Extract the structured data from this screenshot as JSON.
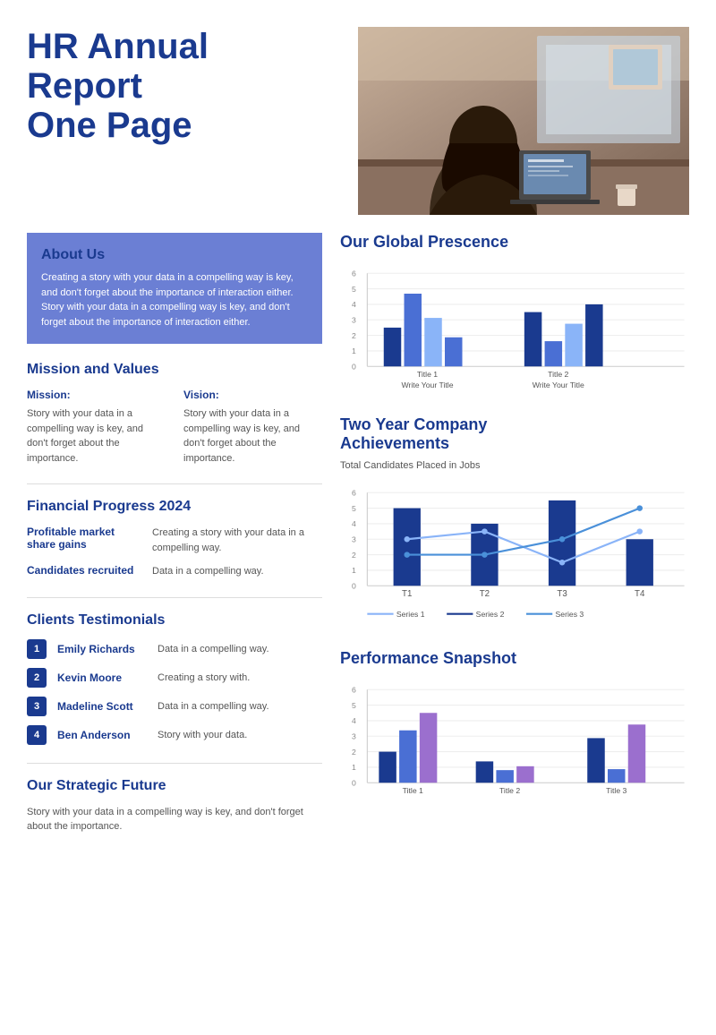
{
  "header": {
    "title_line1": "HR Annual",
    "title_line2": "Report",
    "title_line3": "One Page"
  },
  "about_us": {
    "title": "About Us",
    "text": "Creating a story with your data in a compelling way is key, and don't forget about the importance of interaction either. Story with your data in a compelling way is key, and don't forget about the importance of interaction either."
  },
  "mission_values": {
    "section_title": "Mission and Values",
    "mission_label": "Mission:",
    "mission_text": "Story with your data in a compelling way is key, and don't forget about the importance.",
    "vision_label": "Vision:",
    "vision_text": "Story with your data in a compelling way is key, and don't forget about the importance."
  },
  "financial": {
    "section_title": "Financial Progress 2024",
    "rows": [
      {
        "label": "Profitable market share gains",
        "value": "Creating a story with your data in a compelling way."
      },
      {
        "label": "Candidates recruited",
        "value": "Data in a compelling way."
      }
    ]
  },
  "testimonials": {
    "section_title": "Clients Testimonials",
    "items": [
      {
        "num": "1",
        "name": "Emily Richards",
        "text": "Data in a compelling way."
      },
      {
        "num": "2",
        "name": "Kevin Moore",
        "text": "Creating a story with."
      },
      {
        "num": "3",
        "name": "Madeline Scott",
        "text": "Data in a compelling way."
      },
      {
        "num": "4",
        "name": "Ben Anderson",
        "text": "Story with your data."
      }
    ]
  },
  "strategic_future": {
    "section_title": "Our Strategic Future",
    "text": "Story with your data in a compelling way is key, and don't forget about the importance."
  },
  "global_presence": {
    "section_title": "Our Global Prescence",
    "chart": {
      "y_labels": [
        "6",
        "5",
        "4",
        "3",
        "2",
        "1",
        "0"
      ],
      "groups": [
        {
          "label": "Title 1",
          "subtitle": "Write Your Title",
          "bars": [
            {
              "color": "dark-blue",
              "height": 45
            },
            {
              "color": "medium-blue",
              "height": 80
            },
            {
              "color": "light-blue",
              "height": 55
            },
            {
              "color": "medium-blue",
              "height": 35
            }
          ]
        },
        {
          "label": "Title 2",
          "subtitle": "Write Your Title",
          "bars": [
            {
              "color": "dark-blue",
              "height": 65
            },
            {
              "color": "medium-blue",
              "height": 30
            },
            {
              "color": "light-blue",
              "height": 45
            },
            {
              "color": "dark-blue",
              "height": 75
            }
          ]
        }
      ]
    }
  },
  "two_year": {
    "section_title": "Two Year Company Achievements",
    "subtitle": "Total Candidates Placed in Jobs",
    "chart": {
      "y_max": 6,
      "x_labels": [
        "T1",
        "T2",
        "T3",
        "T4"
      ],
      "series": [
        {
          "name": "Series 1",
          "color": "#8ab4f8",
          "type": "line",
          "values": [
            3,
            3.5,
            1.5,
            3.5
          ]
        },
        {
          "name": "Series 2",
          "color": "#1a3a8f",
          "type": "bar",
          "values": [
            5,
            4,
            5.5,
            3
          ]
        },
        {
          "name": "Series 3",
          "color": "#4a90d9",
          "type": "line",
          "values": [
            2,
            2,
            3,
            5
          ]
        }
      ]
    }
  },
  "performance": {
    "section_title": "Performance Snapshot",
    "chart": {
      "y_labels": [
        "6",
        "5",
        "4",
        "3",
        "2",
        "1",
        "0"
      ],
      "groups": [
        {
          "label": "Title 1",
          "bars": [
            {
              "color": "dark-blue",
              "height": 35
            },
            {
              "color": "medium-blue",
              "height": 55
            },
            {
              "color": "light-purple",
              "height": 75
            }
          ]
        },
        {
          "label": "Title 2",
          "bars": [
            {
              "color": "dark-blue",
              "height": 25
            },
            {
              "color": "medium-blue",
              "height": 15
            },
            {
              "color": "light-purple",
              "height": 20
            }
          ]
        },
        {
          "label": "Title 3",
          "bars": [
            {
              "color": "dark-blue",
              "height": 50
            },
            {
              "color": "medium-blue",
              "height": 15
            },
            {
              "color": "light-purple",
              "height": 65
            }
          ]
        }
      ]
    }
  },
  "colors": {
    "dark_blue": "#1a3a8f",
    "medium_blue": "#4a6fd4",
    "light_blue": "#8ab4f8",
    "about_us_bg": "#6b7fd4",
    "purple": "#9b6fce"
  }
}
